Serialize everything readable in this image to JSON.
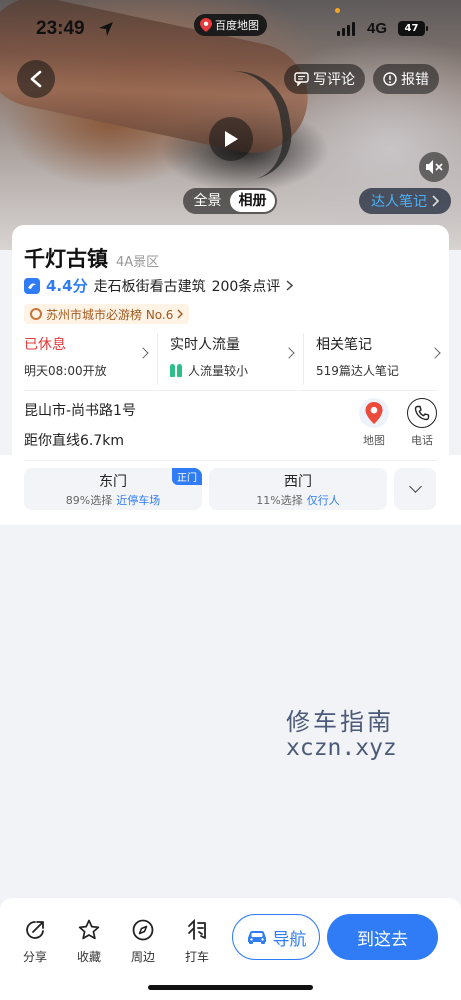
{
  "status_bar": {
    "time": "23:49",
    "app_label": "百度地图",
    "network": "4G",
    "battery": "47"
  },
  "hero": {
    "comment_label": "写评论",
    "report_label": "报错",
    "tabs": [
      {
        "label": "全景",
        "active": false
      },
      {
        "label": "相册",
        "active": true
      }
    ],
    "expert_notes": "达人笔记"
  },
  "place": {
    "name": "千灯古镇",
    "level": "4A景区",
    "score": "4.4分",
    "highlight": "走石板街看古建筑",
    "reviews": "200条点评",
    "rank_tag": "苏州市城市必游榜 No.6"
  },
  "stats": [
    {
      "top": "已休息",
      "bottom": "明天08:00开放"
    },
    {
      "top": "实时人流量",
      "bottom": "人流量较小"
    },
    {
      "top": "相关笔记",
      "bottom": "519篇达人笔记"
    }
  ],
  "location": {
    "address": "昆山市-尚书路1号",
    "distance": "距你直线6.7km",
    "map_label": "地图",
    "phone_label": "电话"
  },
  "gates": [
    {
      "name": "东门",
      "percent": "89%选择",
      "hint": "近停车场",
      "tag": "正门"
    },
    {
      "name": "西门",
      "percent": "11%选择",
      "hint": "仅行人",
      "tag": ""
    }
  ],
  "watermark": {
    "cn": "修车指南",
    "en": "xczn.xyz"
  },
  "bottom_bar": {
    "tools": [
      {
        "label": "分享",
        "icon": "share-icon"
      },
      {
        "label": "收藏",
        "icon": "star-icon"
      },
      {
        "label": "周边",
        "icon": "compass-icon"
      },
      {
        "label": "打车",
        "icon": "taxi-icon"
      }
    ],
    "navigate_label": "导航",
    "go_label": "到这去"
  },
  "colors": {
    "accent": "#2f7cf6",
    "closed": "#e23b3b",
    "expert": "#49b3ff"
  }
}
